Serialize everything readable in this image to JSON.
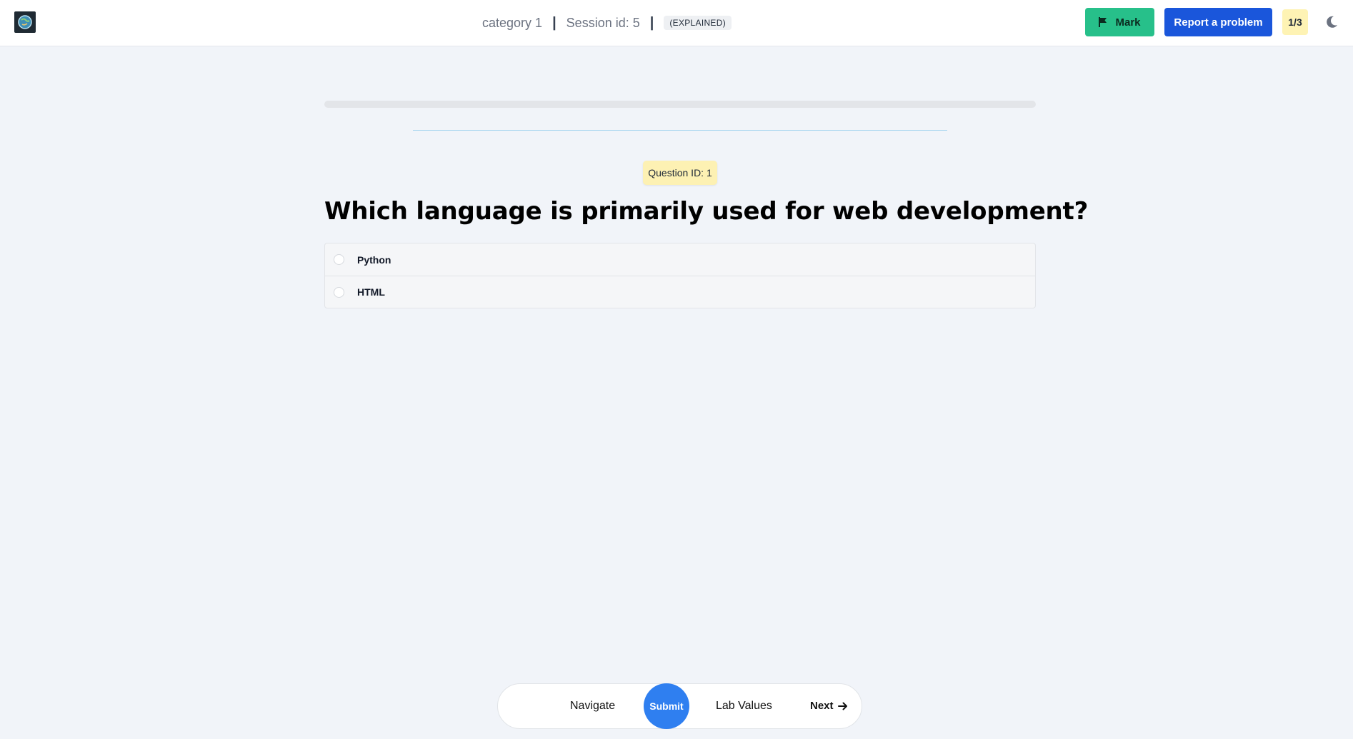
{
  "header": {
    "category": "category 1",
    "separator": "|",
    "session": "Session id: 5",
    "mode": "(EXPLAINED)",
    "mark_label": "Mark",
    "report_label": "Report a problem",
    "counter": "1/3"
  },
  "progress": {
    "fraction": 0.0
  },
  "question": {
    "id_label": "Question ID: 1",
    "text": "Which language is primarily used for web development?",
    "options": [
      {
        "label": "Python"
      },
      {
        "label": "HTML"
      }
    ]
  },
  "footer": {
    "navigate_label": "Navigate",
    "submit_label": "Submit",
    "lab_values_label": "Lab Values",
    "next_label": "Next"
  },
  "colors": {
    "mark": "#27c08a",
    "report": "#1a56db",
    "submit": "#2f7ff0",
    "badge": "#fdf1b3"
  },
  "icons": {
    "logo": "globe-logo-icon",
    "mark": "flag-icon",
    "theme": "moon-icon",
    "next": "arrow-right-icon"
  }
}
